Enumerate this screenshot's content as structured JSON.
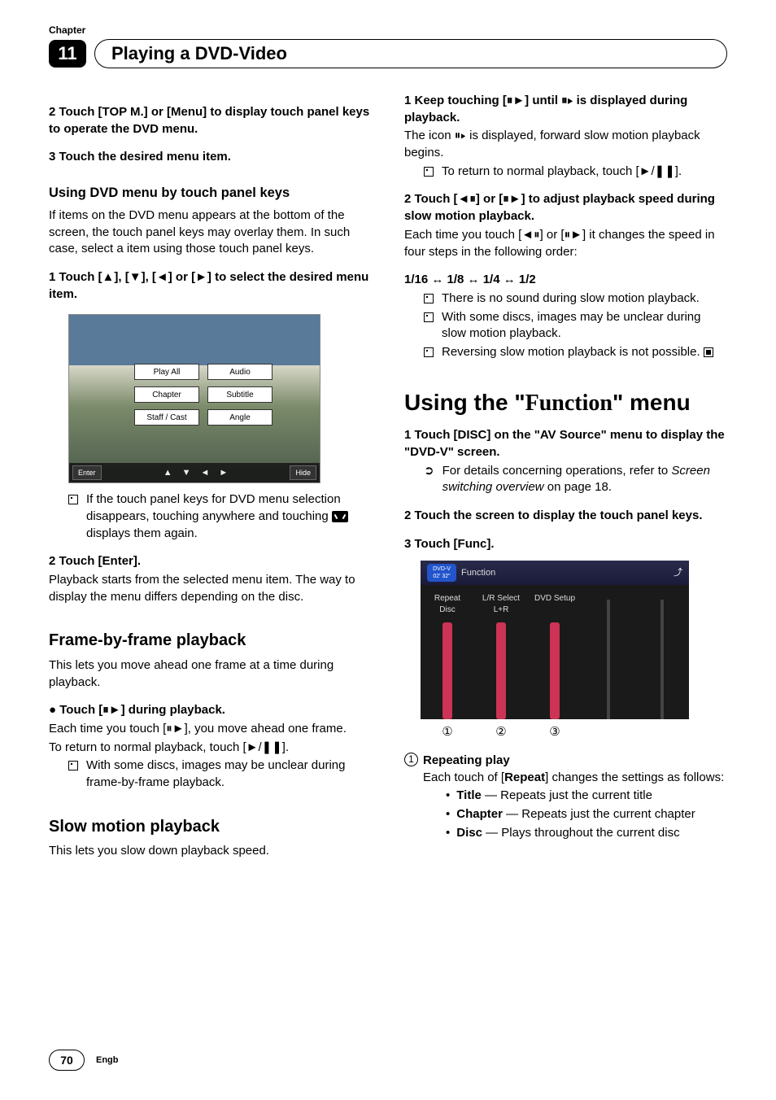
{
  "header": {
    "chapter_label": "Chapter",
    "chapter_number": "11",
    "title": "Playing a DVD-Video"
  },
  "left": {
    "s2": "2    Touch [TOP M.] or [Menu] to display touch panel keys to operate the DVD menu.",
    "s3": "3    Touch the desired menu item.",
    "sub1": "Using DVD menu by touch panel keys",
    "p1": "If items on the DVD menu appears at the bottom of the screen, the touch panel keys may overlay them. In such case, select a item using those touch panel keys.",
    "s1b": "1    Touch [▲], [▼], [◄] or [►] to select the desired menu item.",
    "fig_dvd": {
      "play_all": "Play All",
      "audio": "Audio",
      "chapter": "Chapter",
      "subtitle": "Subtitle",
      "staff": "Staff / Cast",
      "angle": "Angle",
      "enter": "Enter",
      "hide": "Hide"
    },
    "b1a": "If the touch panel keys for DVD menu selection disappears, touching anywhere and touching ",
    "b1b": " displays them again.",
    "s2b": "2    Touch [Enter].",
    "p2": "Playback starts from the selected menu item. The way to display the menu differs depending on the disc.",
    "h_frame": "Frame-by-frame playback",
    "p3": "This lets you move ahead one frame at a time during playback.",
    "bullet_touch": "●    Touch [⏸►] during playback.",
    "p4": "Each time you touch [⏸►], you move ahead one frame.",
    "p5": "To return to normal playback, touch [►/❚❚].",
    "b2": "With some discs, images may be unclear during frame-by-frame playback.",
    "h_slow": "Slow motion playback",
    "p6": "This lets you slow down playback speed."
  },
  "right": {
    "s1": "1    Keep touching [⏸►] until ⏸▸ is displayed during playback.",
    "p1": "The icon ⏸▸ is displayed, forward slow motion playback begins.",
    "b1": "To return to normal playback, touch [►/❚❚].",
    "s2": "2    Touch [◄⏸] or [⏸►] to adjust playback speed during slow motion playback.",
    "p2": "Each time you touch [◄⏸] or [⏸►] it changes the speed in four steps in the following order:",
    "speeds": "1/16 ↔ 1/8 ↔ 1/4 ↔ 1/2",
    "b2": "There is no sound during slow motion playback.",
    "b3": "With some discs, images may be unclear during slow motion playback.",
    "b4a": "Reversing slow motion playback is not possible.",
    "h_func_a": "Using the \"",
    "h_func_b": "Function",
    "h_func_c": "\" menu",
    "s1b": "1    Touch [DISC] on the \"AV Source\" menu to display the \"DVD-V\" screen.",
    "arrow1a": "For details concerning operations, refer to ",
    "arrow1b": "Screen switching overview",
    "arrow1c": " on page 18.",
    "s2b": "2    Touch the screen to display the touch panel keys.",
    "s3": "3    Touch [Func].",
    "fig_func": {
      "title": "Function",
      "dvd": "DVD-V",
      "time": "02' 32\"",
      "repeat": "Repeat",
      "lr": "L/R Select",
      "setup": "DVD Setup",
      "disc": "Disc",
      "lplusr": "L+R"
    },
    "circ1": "①",
    "circ2": "②",
    "circ3": "③",
    "rep_head": "Repeating play",
    "rep_body_a": "Each touch of [",
    "rep_body_b": "Repeat",
    "rep_body_c": "] changes the settings as follows:",
    "li1a": "Title",
    "li1b": " — Repeats just the current title",
    "li2a": "Chapter",
    "li2b": " — Repeats just the current chapter",
    "li3a": "Disc",
    "li3b": " — Plays throughout the current disc"
  },
  "footer": {
    "page": "70",
    "lang": "Engb"
  }
}
